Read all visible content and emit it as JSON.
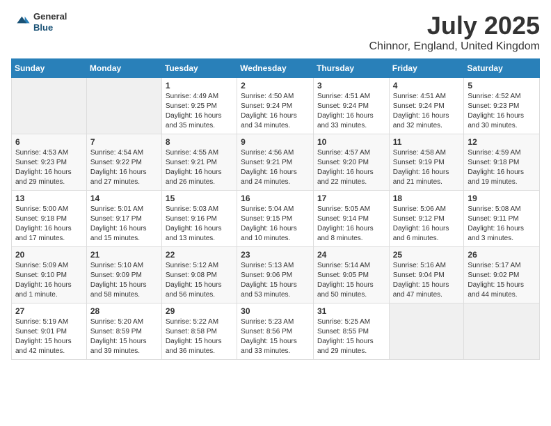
{
  "logo": {
    "general": "General",
    "blue": "Blue"
  },
  "title": "July 2025",
  "subtitle": "Chinnor, England, United Kingdom",
  "weekdays": [
    "Sunday",
    "Monday",
    "Tuesday",
    "Wednesday",
    "Thursday",
    "Friday",
    "Saturday"
  ],
  "weeks": [
    [
      {
        "day": "",
        "empty": true
      },
      {
        "day": "",
        "empty": true
      },
      {
        "day": "1",
        "sunrise": "Sunrise: 4:49 AM",
        "sunset": "Sunset: 9:25 PM",
        "daylight": "Daylight: 16 hours and 35 minutes."
      },
      {
        "day": "2",
        "sunrise": "Sunrise: 4:50 AM",
        "sunset": "Sunset: 9:24 PM",
        "daylight": "Daylight: 16 hours and 34 minutes."
      },
      {
        "day": "3",
        "sunrise": "Sunrise: 4:51 AM",
        "sunset": "Sunset: 9:24 PM",
        "daylight": "Daylight: 16 hours and 33 minutes."
      },
      {
        "day": "4",
        "sunrise": "Sunrise: 4:51 AM",
        "sunset": "Sunset: 9:24 PM",
        "daylight": "Daylight: 16 hours and 32 minutes."
      },
      {
        "day": "5",
        "sunrise": "Sunrise: 4:52 AM",
        "sunset": "Sunset: 9:23 PM",
        "daylight": "Daylight: 16 hours and 30 minutes."
      }
    ],
    [
      {
        "day": "6",
        "sunrise": "Sunrise: 4:53 AM",
        "sunset": "Sunset: 9:23 PM",
        "daylight": "Daylight: 16 hours and 29 minutes."
      },
      {
        "day": "7",
        "sunrise": "Sunrise: 4:54 AM",
        "sunset": "Sunset: 9:22 PM",
        "daylight": "Daylight: 16 hours and 27 minutes."
      },
      {
        "day": "8",
        "sunrise": "Sunrise: 4:55 AM",
        "sunset": "Sunset: 9:21 PM",
        "daylight": "Daylight: 16 hours and 26 minutes."
      },
      {
        "day": "9",
        "sunrise": "Sunrise: 4:56 AM",
        "sunset": "Sunset: 9:21 PM",
        "daylight": "Daylight: 16 hours and 24 minutes."
      },
      {
        "day": "10",
        "sunrise": "Sunrise: 4:57 AM",
        "sunset": "Sunset: 9:20 PM",
        "daylight": "Daylight: 16 hours and 22 minutes."
      },
      {
        "day": "11",
        "sunrise": "Sunrise: 4:58 AM",
        "sunset": "Sunset: 9:19 PM",
        "daylight": "Daylight: 16 hours and 21 minutes."
      },
      {
        "day": "12",
        "sunrise": "Sunrise: 4:59 AM",
        "sunset": "Sunset: 9:18 PM",
        "daylight": "Daylight: 16 hours and 19 minutes."
      }
    ],
    [
      {
        "day": "13",
        "sunrise": "Sunrise: 5:00 AM",
        "sunset": "Sunset: 9:18 PM",
        "daylight": "Daylight: 16 hours and 17 minutes."
      },
      {
        "day": "14",
        "sunrise": "Sunrise: 5:01 AM",
        "sunset": "Sunset: 9:17 PM",
        "daylight": "Daylight: 16 hours and 15 minutes."
      },
      {
        "day": "15",
        "sunrise": "Sunrise: 5:03 AM",
        "sunset": "Sunset: 9:16 PM",
        "daylight": "Daylight: 16 hours and 13 minutes."
      },
      {
        "day": "16",
        "sunrise": "Sunrise: 5:04 AM",
        "sunset": "Sunset: 9:15 PM",
        "daylight": "Daylight: 16 hours and 10 minutes."
      },
      {
        "day": "17",
        "sunrise": "Sunrise: 5:05 AM",
        "sunset": "Sunset: 9:14 PM",
        "daylight": "Daylight: 16 hours and 8 minutes."
      },
      {
        "day": "18",
        "sunrise": "Sunrise: 5:06 AM",
        "sunset": "Sunset: 9:12 PM",
        "daylight": "Daylight: 16 hours and 6 minutes."
      },
      {
        "day": "19",
        "sunrise": "Sunrise: 5:08 AM",
        "sunset": "Sunset: 9:11 PM",
        "daylight": "Daylight: 16 hours and 3 minutes."
      }
    ],
    [
      {
        "day": "20",
        "sunrise": "Sunrise: 5:09 AM",
        "sunset": "Sunset: 9:10 PM",
        "daylight": "Daylight: 16 hours and 1 minute."
      },
      {
        "day": "21",
        "sunrise": "Sunrise: 5:10 AM",
        "sunset": "Sunset: 9:09 PM",
        "daylight": "Daylight: 15 hours and 58 minutes."
      },
      {
        "day": "22",
        "sunrise": "Sunrise: 5:12 AM",
        "sunset": "Sunset: 9:08 PM",
        "daylight": "Daylight: 15 hours and 56 minutes."
      },
      {
        "day": "23",
        "sunrise": "Sunrise: 5:13 AM",
        "sunset": "Sunset: 9:06 PM",
        "daylight": "Daylight: 15 hours and 53 minutes."
      },
      {
        "day": "24",
        "sunrise": "Sunrise: 5:14 AM",
        "sunset": "Sunset: 9:05 PM",
        "daylight": "Daylight: 15 hours and 50 minutes."
      },
      {
        "day": "25",
        "sunrise": "Sunrise: 5:16 AM",
        "sunset": "Sunset: 9:04 PM",
        "daylight": "Daylight: 15 hours and 47 minutes."
      },
      {
        "day": "26",
        "sunrise": "Sunrise: 5:17 AM",
        "sunset": "Sunset: 9:02 PM",
        "daylight": "Daylight: 15 hours and 44 minutes."
      }
    ],
    [
      {
        "day": "27",
        "sunrise": "Sunrise: 5:19 AM",
        "sunset": "Sunset: 9:01 PM",
        "daylight": "Daylight: 15 hours and 42 minutes."
      },
      {
        "day": "28",
        "sunrise": "Sunrise: 5:20 AM",
        "sunset": "Sunset: 8:59 PM",
        "daylight": "Daylight: 15 hours and 39 minutes."
      },
      {
        "day": "29",
        "sunrise": "Sunrise: 5:22 AM",
        "sunset": "Sunset: 8:58 PM",
        "daylight": "Daylight: 15 hours and 36 minutes."
      },
      {
        "day": "30",
        "sunrise": "Sunrise: 5:23 AM",
        "sunset": "Sunset: 8:56 PM",
        "daylight": "Daylight: 15 hours and 33 minutes."
      },
      {
        "day": "31",
        "sunrise": "Sunrise: 5:25 AM",
        "sunset": "Sunset: 8:55 PM",
        "daylight": "Daylight: 15 hours and 29 minutes."
      },
      {
        "day": "",
        "empty": true
      },
      {
        "day": "",
        "empty": true
      }
    ]
  ]
}
